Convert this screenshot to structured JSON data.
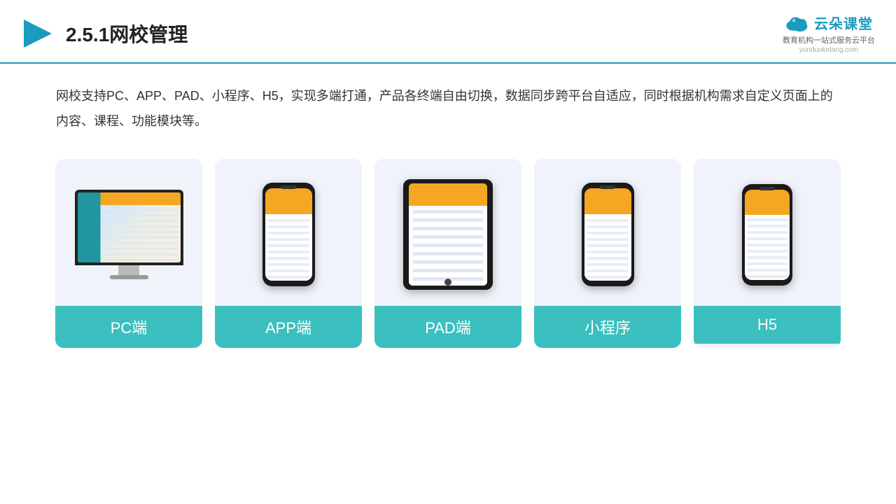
{
  "header": {
    "title": "2.5.1网校管理",
    "logo_main": "云朵课堂",
    "logo_sub": "yunduoketang.com",
    "logo_tagline_line1": "教育机构一站",
    "logo_tagline_line2": "式服务云平台"
  },
  "description": {
    "text": "网校支持PC、APP、PAD、小程序、H5，实现多端打通，产品各终端自由切换，数据同步跨平台自适应，同时根据机构需求自定义页面上的内容、课程、功能模块等。"
  },
  "cards": [
    {
      "id": "pc",
      "label": "PC端"
    },
    {
      "id": "app",
      "label": "APP端"
    },
    {
      "id": "pad",
      "label": "PAD端"
    },
    {
      "id": "miniapp",
      "label": "小程序"
    },
    {
      "id": "h5",
      "label": "H5"
    }
  ],
  "colors": {
    "accent": "#3bbfbf",
    "header_border": "#1a9bbf",
    "title_color": "#222"
  }
}
